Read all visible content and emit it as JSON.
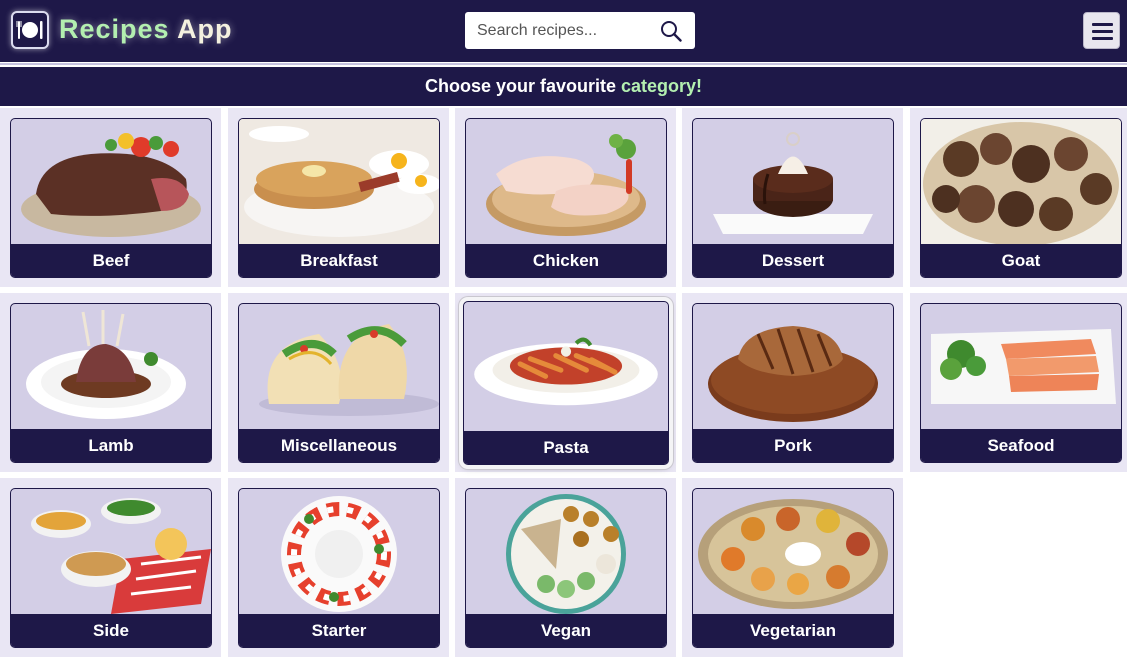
{
  "header": {
    "title_part1": "Recipes",
    "title_part2": "App",
    "logo_icon": "plate-cutlery-icon",
    "search_placeholder": "Search recipes...",
    "search_icon": "magnifier-icon",
    "menu_icon": "hamburger-menu-icon"
  },
  "banner": {
    "text": "Choose your favourite",
    "highlight": "category!"
  },
  "colors": {
    "navy": "#1e1848",
    "accent_green": "#b3efb0",
    "tile_bg": "#e9e6f4",
    "card_bg": "#d3cee6"
  },
  "categories": [
    {
      "label": "Beef",
      "image": "steak-icon"
    },
    {
      "label": "Breakfast",
      "image": "pancakes-eggs-icon"
    },
    {
      "label": "Chicken",
      "image": "raw-chicken-icon"
    },
    {
      "label": "Dessert",
      "image": "chocolate-cake-icon"
    },
    {
      "label": "Goat",
      "image": "goat-meat-icon"
    },
    {
      "label": "Lamb",
      "image": "lamb-chops-icon"
    },
    {
      "label": "Miscellaneous",
      "image": "tacos-icon"
    },
    {
      "label": "Pasta",
      "image": "pasta-bowl-icon",
      "active": true
    },
    {
      "label": "Pork",
      "image": "pork-steak-icon"
    },
    {
      "label": "Seafood",
      "image": "salmon-plate-icon"
    },
    {
      "label": "Side",
      "image": "side-dishes-icon"
    },
    {
      "label": "Starter",
      "image": "caprese-starter-icon"
    },
    {
      "label": "Vegan",
      "image": "vegan-bowl-icon"
    },
    {
      "label": "Vegetarian",
      "image": "thali-platter-icon"
    }
  ]
}
